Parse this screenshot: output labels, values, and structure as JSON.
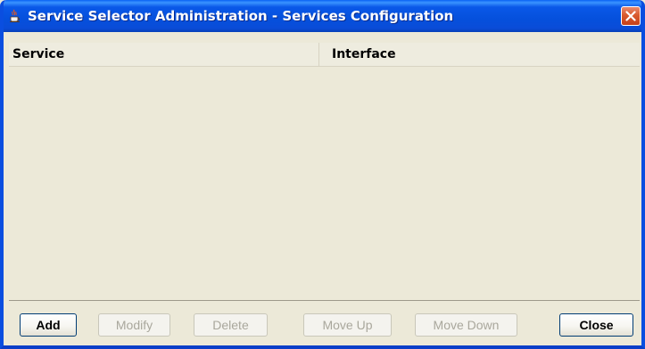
{
  "window": {
    "title": "Service Selector Administration - Services Configuration",
    "icon": "java-cup-icon",
    "close_icon": "close-icon"
  },
  "table": {
    "columns": [
      "Service",
      "Interface"
    ],
    "rows": []
  },
  "buttons": {
    "add": "Add",
    "modify": "Modify",
    "delete": "Delete",
    "move_up": "Move Up",
    "move_down": "Move Down",
    "close": "Close"
  },
  "colors": {
    "titlebar": "#0550dc",
    "window_bg": "#ece9d8",
    "close_button": "#d95a2e"
  }
}
